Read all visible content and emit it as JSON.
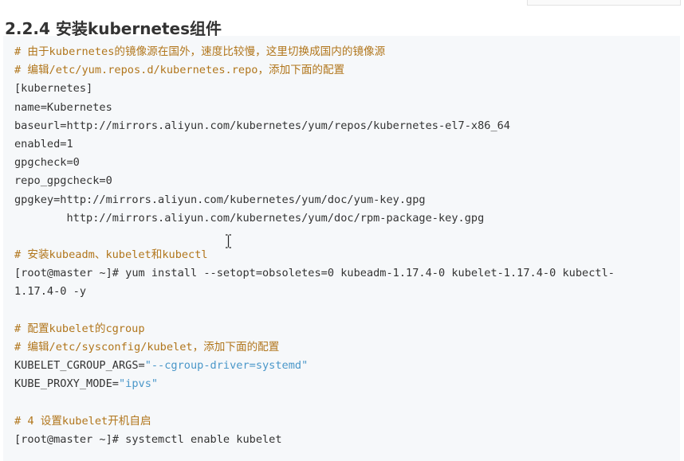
{
  "heading": "2.2.4 安装kubernetes组件",
  "code_lines": [
    {
      "parts": [
        {
          "text": "# 由于kubernetes的镜像源在国外，速度比较慢，这里切换成国内的镜像源",
          "style": "comment"
        }
      ]
    },
    {
      "parts": [
        {
          "text": "# 编辑/etc/yum.repos.d/kubernetes.repo，添加下面的配置",
          "style": "comment"
        }
      ]
    },
    {
      "parts": [
        {
          "text": "[kubernetes]",
          "style": "plain"
        }
      ]
    },
    {
      "parts": [
        {
          "text": "name=Kubernetes",
          "style": "plain"
        }
      ]
    },
    {
      "parts": [
        {
          "text": "baseurl=http://mirrors.aliyun.com/kubernetes/yum/repos/kubernetes-el7-x86_64",
          "style": "plain"
        }
      ]
    },
    {
      "parts": [
        {
          "text": "enabled=1",
          "style": "plain"
        }
      ]
    },
    {
      "parts": [
        {
          "text": "gpgcheck=0",
          "style": "plain"
        }
      ]
    },
    {
      "parts": [
        {
          "text": "repo_gpgcheck=0",
          "style": "plain"
        }
      ]
    },
    {
      "parts": [
        {
          "text": "gpgkey=http://mirrors.aliyun.com/kubernetes/yum/doc/yum-key.gpg",
          "style": "plain"
        }
      ]
    },
    {
      "parts": [
        {
          "text": "        http://mirrors.aliyun.com/kubernetes/yum/doc/rpm-package-key.gpg",
          "style": "plain"
        }
      ]
    },
    {
      "parts": []
    },
    {
      "parts": [
        {
          "text": "# 安装kubeadm、kubelet和kubectl",
          "style": "comment"
        }
      ]
    },
    {
      "parts": [
        {
          "text": "[root@master ~]# yum install --setopt=obsoletes=0 kubeadm-1.17.4-0 kubelet-1.17.4-0 kubectl-",
          "style": "plain"
        }
      ]
    },
    {
      "parts": [
        {
          "text": "1.17.4-0 -y",
          "style": "plain"
        }
      ]
    },
    {
      "parts": []
    },
    {
      "parts": [
        {
          "text": "# 配置kubelet的cgroup",
          "style": "comment"
        }
      ]
    },
    {
      "parts": [
        {
          "text": "# 编辑/etc/sysconfig/kubelet，添加下面的配置",
          "style": "comment"
        }
      ]
    },
    {
      "parts": [
        {
          "text": "KUBELET_CGROUP_ARGS=",
          "style": "plain"
        },
        {
          "text": "\"--cgroup-driver=systemd\"",
          "style": "string"
        }
      ]
    },
    {
      "parts": [
        {
          "text": "KUBE_PROXY_MODE=",
          "style": "plain"
        },
        {
          "text": "\"ipvs\"",
          "style": "string"
        }
      ]
    },
    {
      "parts": []
    },
    {
      "parts": [
        {
          "text": "# 4 设置kubelet开机自启",
          "style": "comment"
        }
      ]
    },
    {
      "parts": [
        {
          "text": "[root@master ~]# systemctl enable kubelet",
          "style": "plain"
        }
      ]
    }
  ],
  "colors": {
    "comment": "#b1761c",
    "string": "#4a97c9",
    "plain": "#333333",
    "code_background": "#f6f8fa"
  },
  "icons": {
    "cursor": "text-cursor-icon"
  }
}
